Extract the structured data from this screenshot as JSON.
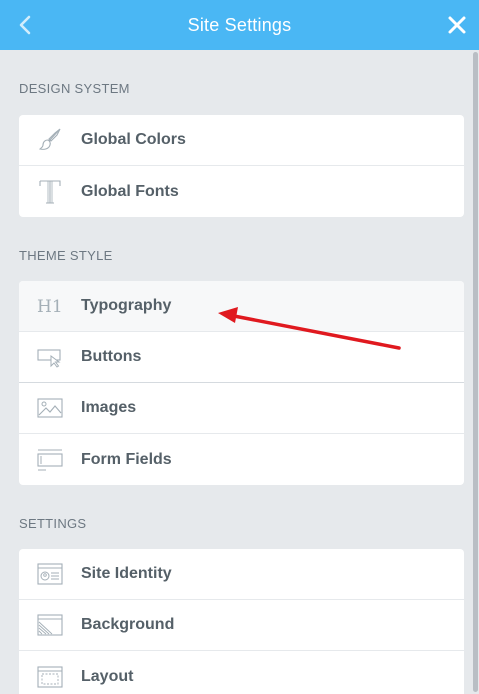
{
  "header": {
    "title": "Site Settings",
    "back_icon": "chevron-left-icon",
    "close_icon": "close-icon",
    "color": "#4ab7f4"
  },
  "sections": [
    {
      "title": "DESIGN SYSTEM",
      "items": [
        {
          "label": "Global Colors",
          "icon": "brush-icon"
        },
        {
          "label": "Global Fonts",
          "icon": "font-t-icon"
        }
      ]
    },
    {
      "title": "THEME STYLE",
      "items": [
        {
          "label": "Typography",
          "icon": "heading-h1-icon"
        },
        {
          "label": "Buttons",
          "icon": "button-cursor-icon"
        },
        {
          "label": "Images",
          "icon": "image-icon"
        },
        {
          "label": "Form Fields",
          "icon": "form-fields-icon"
        }
      ]
    },
    {
      "title": "SETTINGS",
      "items": [
        {
          "label": "Site Identity",
          "icon": "site-identity-icon"
        },
        {
          "label": "Background",
          "icon": "background-icon"
        },
        {
          "label": "Layout",
          "icon": "layout-icon"
        }
      ]
    }
  ],
  "annotation": {
    "icon": "red-arrow-pointer",
    "color": "#e0191f"
  }
}
